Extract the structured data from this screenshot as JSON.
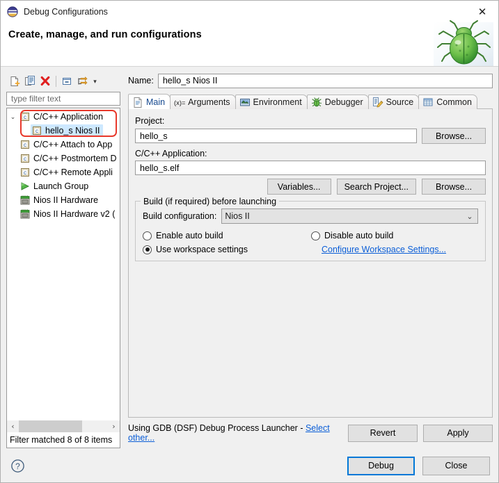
{
  "window": {
    "title": "Debug Configurations",
    "icon": "eclipse-debug-icon",
    "close_label": "✕"
  },
  "header": {
    "title": "Create, manage, and run configurations",
    "image": "green-bug-icon"
  },
  "tree_toolbar": {
    "buttons": [
      {
        "name": "new-launch-configuration-button",
        "icon": "new-config-icon",
        "tooltip": "New launch configuration"
      },
      {
        "name": "duplicate-configuration-button",
        "icon": "duplicate-icon",
        "tooltip": "Duplicate currently selected launch configuration"
      },
      {
        "name": "delete-configuration-button",
        "icon": "delete-red-x-icon",
        "tooltip": "Delete selected launch configuration(s)"
      },
      {
        "name": "collapse-all-button",
        "icon": "collapse-all-icon",
        "tooltip": "Collapse All"
      },
      {
        "name": "filter-launch-configurations-button",
        "icon": "filter-arrows-icon",
        "tooltip": "Filter launch configurations"
      }
    ],
    "dropdown_arrow": "▾"
  },
  "filter": {
    "placeholder": "type filter text",
    "value": "",
    "status": "Filter matched 8 of 8 items"
  },
  "tree": {
    "items": [
      {
        "label": "C/C++ Application",
        "icon": "c-app-icon",
        "indent": 0,
        "expanded": true,
        "selected": false,
        "twisty": "⌄"
      },
      {
        "label": "hello_s Nios II",
        "icon": "c-app-icon",
        "indent": 1,
        "expanded": false,
        "selected": true,
        "twisty": ""
      },
      {
        "label": "C/C++ Attach to App",
        "icon": "c-app-icon",
        "indent": 0,
        "expanded": false,
        "selected": false,
        "twisty": ""
      },
      {
        "label": "C/C++ Postmortem D",
        "icon": "c-app-icon",
        "indent": 0,
        "expanded": false,
        "selected": false,
        "twisty": ""
      },
      {
        "label": "C/C++ Remote Appli",
        "icon": "c-app-icon",
        "indent": 0,
        "expanded": false,
        "selected": false,
        "twisty": ""
      },
      {
        "label": "Launch Group",
        "icon": "green-play-icon",
        "indent": 0,
        "expanded": false,
        "selected": false,
        "twisty": ""
      },
      {
        "label": "Nios II Hardware",
        "icon": "nios-board-icon",
        "indent": 0,
        "expanded": false,
        "selected": false,
        "twisty": ""
      },
      {
        "label": "Nios II Hardware v2 (",
        "icon": "nios-board-icon",
        "indent": 0,
        "expanded": false,
        "selected": false,
        "twisty": ""
      }
    ],
    "hscroll": {
      "left_arrow": "‹",
      "right_arrow": "›"
    }
  },
  "name_field": {
    "label": "Name:",
    "value": "hello_s Nios II",
    "placeholder": ""
  },
  "tabs": [
    {
      "label": "Main",
      "icon": "main-document-icon",
      "active": true
    },
    {
      "label": "Arguments",
      "icon": "arguments-xequals-icon",
      "active": false
    },
    {
      "label": "Environment",
      "icon": "environment-icon",
      "active": false
    },
    {
      "label": "Debugger",
      "icon": "debugger-bug-icon",
      "active": false
    },
    {
      "label": "Source",
      "icon": "source-pencil-icon",
      "active": false
    },
    {
      "label": "Common",
      "icon": "common-table-icon",
      "active": false
    }
  ],
  "main_tab": {
    "project": {
      "label": "Project:",
      "value": "hello_s",
      "browse_label": "Browse..."
    },
    "application": {
      "label": "C/C++ Application:",
      "value": "hello_s.elf",
      "variables_label": "Variables...",
      "search_project_label": "Search Project...",
      "browse_label": "Browse..."
    },
    "build_group": {
      "legend": "Build (if required) before launching",
      "build_configuration_label": "Build configuration:",
      "build_configuration_value": "Nios II",
      "build_configuration_arrow": "⌄",
      "radios": [
        {
          "label": "Enable auto build",
          "checked": false
        },
        {
          "label": "Disable auto build",
          "checked": false
        },
        {
          "label": "Use workspace settings",
          "checked": true
        }
      ],
      "configure_link": "Configure Workspace Settings..."
    }
  },
  "apply_bar": {
    "launcher_text": "Using GDB (DSF) Debug Process Launcher - ",
    "select_other_link": "Select other...",
    "revert_label": "Revert",
    "apply_label": "Apply"
  },
  "footer": {
    "help_icon": "question-mark-help-icon",
    "debug_label": "Debug",
    "close_label": "Close"
  },
  "colors": {
    "accent_blue": "#0078d7",
    "link_blue": "#0b5ed7",
    "selection_blue": "#cde8ff",
    "annotation_red": "#e8382b",
    "dialog_bg": "#f0f0f0",
    "active_tab_text": "#16498f"
  }
}
